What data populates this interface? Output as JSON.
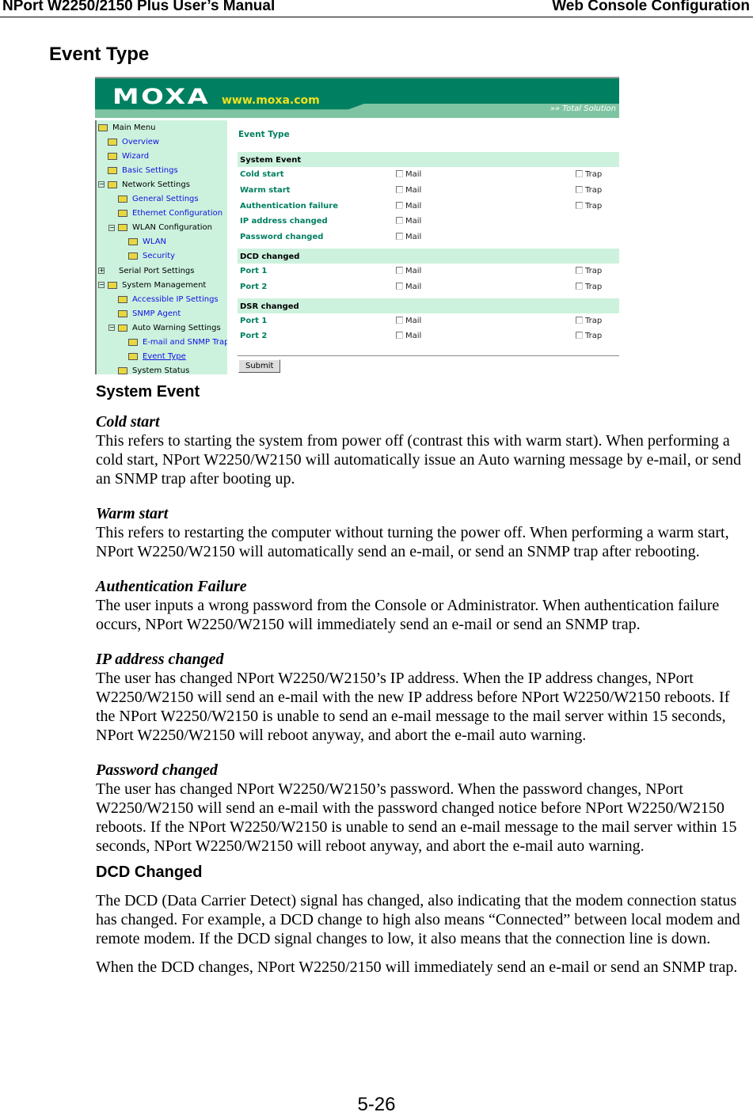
{
  "header": {
    "left": "NPort W2250/2150 Plus User’s Manual",
    "right": "Web Console Configuration"
  },
  "page_title": "Event Type",
  "screenshot": {
    "logo": "MOXA",
    "url": "www.moxa.com",
    "tagline": "Total Solution",
    "menu": [
      {
        "label": "Main Menu",
        "level": 0,
        "type": "folder",
        "link": false
      },
      {
        "label": "Overview",
        "level": 1,
        "type": "folder",
        "link": true
      },
      {
        "label": "Wizard",
        "level": 1,
        "type": "folder",
        "link": true
      },
      {
        "label": "Basic Settings",
        "level": 1,
        "type": "folder",
        "link": true
      },
      {
        "label": "Network Settings",
        "level": 1,
        "type": "open",
        "link": false
      },
      {
        "label": "General Settings",
        "level": 2,
        "type": "folder",
        "link": true
      },
      {
        "label": "Ethernet Configuration",
        "level": 2,
        "type": "folder",
        "link": true
      },
      {
        "label": "WLAN Configuration",
        "level": 2,
        "type": "open",
        "link": false
      },
      {
        "label": "WLAN",
        "level": 3,
        "type": "folder",
        "link": true
      },
      {
        "label": "Security",
        "level": 3,
        "type": "folder",
        "link": true
      },
      {
        "label": "Serial Port Settings",
        "level": 1,
        "type": "plus",
        "link": false
      },
      {
        "label": "System Management",
        "level": 1,
        "type": "open",
        "link": false
      },
      {
        "label": "Accessible IP Settings",
        "level": 2,
        "type": "folder",
        "link": true
      },
      {
        "label": "SNMP Agent",
        "level": 2,
        "type": "folder",
        "link": true
      },
      {
        "label": "Auto Warning Settings",
        "level": 2,
        "type": "open",
        "link": false
      },
      {
        "label": "E-mail and SNMP Trap",
        "level": 3,
        "type": "folder",
        "link": true
      },
      {
        "label": "Event Type",
        "level": 3,
        "type": "folder",
        "link": true
      },
      {
        "label": "System Status",
        "level": 2,
        "type": "folder",
        "link": false
      }
    ],
    "form_title": "Event Type",
    "mail_label": "Mail",
    "trap_label": "Trap",
    "sections": [
      {
        "title": "System Event",
        "rows": [
          {
            "name": "Cold start",
            "mail": false,
            "trap": false
          },
          {
            "name": "Warm start",
            "mail": false,
            "trap": false
          },
          {
            "name": "Authentication failure",
            "mail": false,
            "trap": false
          },
          {
            "name": "IP address changed",
            "mail": false
          },
          {
            "name": "Password changed",
            "mail": false
          }
        ]
      },
      {
        "title": "DCD changed",
        "rows": [
          {
            "name": "Port 1",
            "mail": false,
            "trap": false
          },
          {
            "name": "Port 2",
            "mail": false,
            "trap": false
          }
        ]
      },
      {
        "title": "DSR changed",
        "rows": [
          {
            "name": "Port 1",
            "mail": false,
            "trap": false
          },
          {
            "name": "Port 2",
            "mail": false,
            "trap": false
          }
        ]
      }
    ],
    "submit": "Submit"
  },
  "body": {
    "system_event_heading": "System Event",
    "items": [
      {
        "term": "Cold start",
        "text": "This refers to starting the system from power off (contrast this with warm start). When performing a cold start, NPort W2250/W2150 will automatically issue an Auto warning message by e-mail, or send an SNMP trap after booting up."
      },
      {
        "term": "Warm start",
        "text": "This refers to restarting the computer without turning the power off. When performing a warm start, NPort W2250/W2150 will automatically send an e-mail, or send an SNMP trap after rebooting."
      },
      {
        "term": "Authentication Failure",
        "text": "The user inputs a wrong password from the Console or Administrator. When authentication failure occurs, NPort W2250/W2150 will immediately send an e-mail or send an SNMP trap."
      },
      {
        "term": "IP address changed",
        "text": "The user has changed NPort W2250/W2150’s IP address. When the IP address changes, NPort W2250/W2150 will send an e-mail with the new IP address before NPort W2250/W2150 reboots. If the NPort W2250/W2150 is unable to send an e-mail message to the mail server within 15 seconds, NPort W2250/W2150 will reboot anyway, and abort the e-mail auto warning."
      },
      {
        "term": "Password changed",
        "text": "The user has changed NPort W2250/W2150’s password. When the password changes, NPort W2250/W2150 will send an e-mail with the password changed notice before NPort W2250/W2150 reboots. If the NPort W2250/W2150 is unable to send an e-mail message to the mail server within 15 seconds, NPort W2250/W2150 will reboot anyway, and abort the e-mail auto warning."
      }
    ],
    "dcd_heading": "DCD Changed",
    "dcd_paragraphs": [
      "The DCD (Data Carrier Detect) signal has changed, also indicating that the modem connection status has changed. For example, a DCD change to high also means “Connected” between local modem and remote modem. If the DCD signal changes to low, it also means that the connection line is down.",
      "When the DCD changes, NPort W2250/2150 will immediately send an e-mail or send an SNMP trap."
    ]
  },
  "page_number": "5-26"
}
